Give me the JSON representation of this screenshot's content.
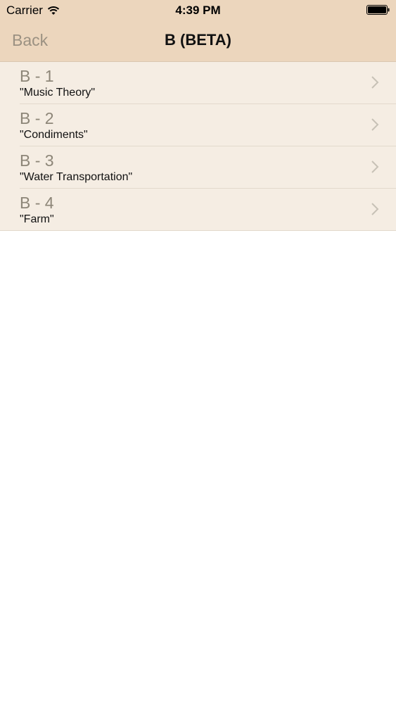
{
  "status_bar": {
    "carrier": "Carrier",
    "time": "4:39 PM"
  },
  "nav": {
    "back_label": "Back",
    "title": "B (BETA)"
  },
  "rows": [
    {
      "title": "B - 1",
      "subtitle": "\"Music Theory\""
    },
    {
      "title": "B - 2",
      "subtitle": "\"Condiments\""
    },
    {
      "title": "B - 3",
      "subtitle": "\"Water Transportation\""
    },
    {
      "title": "B - 4",
      "subtitle": "\"Farm\""
    }
  ],
  "colors": {
    "nav_background": "#ecd6bd",
    "row_background": "#f5ede3",
    "back_text": "#9b9182",
    "row_title_text": "#8d8678"
  }
}
